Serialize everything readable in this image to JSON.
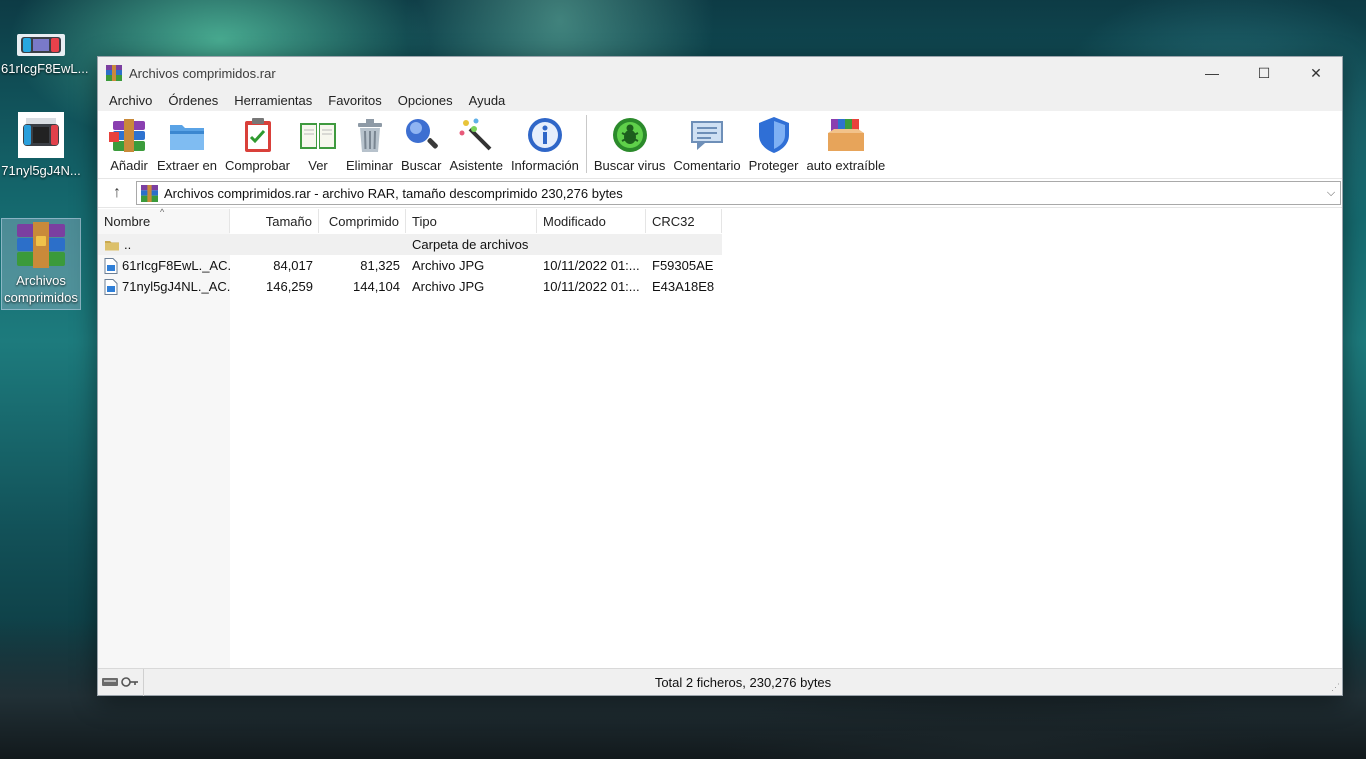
{
  "desktop": {
    "icons": [
      {
        "label": "61rIcgF8EwL..."
      },
      {
        "label": "71nyl5gJ4N..."
      },
      {
        "label": "Archivos comprimidos"
      }
    ]
  },
  "window": {
    "title": "Archivos comprimidos.rar",
    "controls": {
      "minimize": "—",
      "maximize": "☐",
      "close": "✕"
    }
  },
  "menu": [
    "Archivo",
    "Órdenes",
    "Herramientas",
    "Favoritos",
    "Opciones",
    "Ayuda"
  ],
  "toolbar": [
    {
      "label": "Añadir",
      "icon": "add-archive-icon"
    },
    {
      "label": "Extraer en",
      "icon": "extract-folder-icon"
    },
    {
      "label": "Comprobar",
      "icon": "test-clipboard-icon"
    },
    {
      "label": "Ver",
      "icon": "view-book-icon"
    },
    {
      "label": "Eliminar",
      "icon": "trash-icon"
    },
    {
      "label": "Buscar",
      "icon": "magnifier-icon"
    },
    {
      "label": "Asistente",
      "icon": "wizard-wand-icon"
    },
    {
      "label": "Información",
      "icon": "info-icon"
    },
    {
      "label": "Buscar virus",
      "icon": "virus-scan-icon"
    },
    {
      "label": "Comentario",
      "icon": "comment-icon"
    },
    {
      "label": "Proteger",
      "icon": "shield-icon"
    },
    {
      "label": "auto extraíble",
      "icon": "sfx-box-icon"
    }
  ],
  "address": {
    "up": "↑",
    "text": "Archivos comprimidos.rar - archivo RAR, tamaño descomprimido 230,276 bytes",
    "dropdown": "⌵"
  },
  "columns": [
    "Nombre",
    "Tamaño",
    "Comprimido",
    "Tipo",
    "Modificado",
    "CRC32"
  ],
  "sort_indicator": "^",
  "rows": [
    {
      "name": "..",
      "size": "",
      "packed": "",
      "type": "Carpeta de archivos",
      "modified": "",
      "crc": ""
    },
    {
      "name": "61rIcgF8EwL._AC...",
      "size": "84,017",
      "packed": "81,325",
      "type": "Archivo JPG",
      "modified": "10/11/2022 01:...",
      "crc": "F59305AE"
    },
    {
      "name": "71nyl5gJ4NL._AC...",
      "size": "146,259",
      "packed": "144,104",
      "type": "Archivo JPG",
      "modified": "10/11/2022 01:...",
      "crc": "E43A18E8"
    }
  ],
  "status": {
    "text": "Total 2 ficheros, 230,276 bytes"
  },
  "colors": {
    "accent": "#0078d7",
    "toolbar_bg": "#ffffff",
    "chrome_bg": "#f0f0f0"
  }
}
